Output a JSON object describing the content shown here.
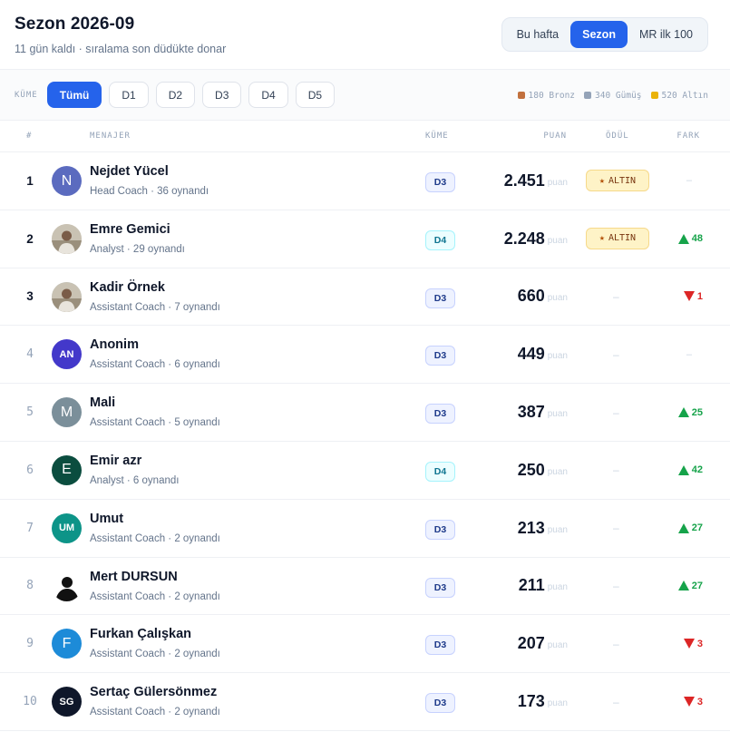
{
  "header": {
    "title": "Sezon 2026-09",
    "subtitle": "11 gün kaldı · sıralama son düdükte donar",
    "tabs": [
      {
        "label": "Bu hafta",
        "active": false
      },
      {
        "label": "Sezon",
        "active": true
      },
      {
        "label": "MR ilk 100",
        "active": false
      }
    ]
  },
  "filters": {
    "label": "KÜME",
    "chips": [
      {
        "label": "Tümü",
        "active": true
      },
      {
        "label": "D1",
        "active": false
      },
      {
        "label": "D2",
        "active": false
      },
      {
        "label": "D3",
        "active": false
      },
      {
        "label": "D4",
        "active": false
      },
      {
        "label": "D5",
        "active": false
      }
    ],
    "legend": [
      {
        "label": "180 Bronz",
        "color": "#c2713e"
      },
      {
        "label": "340 Gümüş",
        "color": "#94a3b8"
      },
      {
        "label": "520 Altın",
        "color": "#eab308"
      }
    ]
  },
  "table": {
    "columns": {
      "rank": "#",
      "manager": "MENAJER",
      "league": "KÜME",
      "points": "PUAN",
      "award": "ÖDÜL",
      "diff": "FARK"
    },
    "points_unit": "puan",
    "rows": [
      {
        "rank": "1",
        "name": "Nejdet Yücel",
        "meta": "Head Coach · 36 oynandı",
        "league": "D3",
        "points": "2.451",
        "award": "ALTIN",
        "diff": "",
        "diff_dir": "none",
        "avatar": {
          "type": "letter",
          "text": "N",
          "color": "#5b6bbf"
        }
      },
      {
        "rank": "2",
        "name": "Emre Gemici",
        "meta": "Analyst · 29 oynandı",
        "league": "D4",
        "points": "2.248",
        "award": "ALTIN",
        "diff": "48",
        "diff_dir": "up",
        "avatar": {
          "type": "photo",
          "color": "#d6cfc2"
        }
      },
      {
        "rank": "3",
        "name": "Kadir Örnek",
        "meta": "Assistant Coach · 7 oynandı",
        "league": "D3",
        "points": "660",
        "award": "",
        "diff": "1",
        "diff_dir": "down",
        "avatar": {
          "type": "photo",
          "color": "#bcd3de"
        }
      },
      {
        "rank": "4",
        "name": "Anonim",
        "meta": "Assistant Coach · 6 oynandı",
        "league": "D3",
        "points": "449",
        "award": "",
        "diff": "",
        "diff_dir": "none",
        "avatar": {
          "type": "initials",
          "text": "AN",
          "color": "#4338ca"
        }
      },
      {
        "rank": "5",
        "name": "Mali",
        "meta": "Assistant Coach · 5 oynandı",
        "league": "D3",
        "points": "387",
        "award": "",
        "diff": "25",
        "diff_dir": "up",
        "avatar": {
          "type": "letter",
          "text": "M",
          "color": "#7b8f9a"
        }
      },
      {
        "rank": "6",
        "name": "Emir azr",
        "meta": "Analyst · 6 oynandı",
        "league": "D4",
        "points": "250",
        "award": "",
        "diff": "42",
        "diff_dir": "up",
        "avatar": {
          "type": "letter",
          "text": "E",
          "color": "#0b4d3f"
        }
      },
      {
        "rank": "7",
        "name": "Umut",
        "meta": "Assistant Coach · 2 oynandı",
        "league": "D3",
        "points": "213",
        "award": "",
        "diff": "27",
        "diff_dir": "up",
        "avatar": {
          "type": "initials",
          "text": "UM",
          "color": "#0d9488"
        }
      },
      {
        "rank": "8",
        "name": "Mert DURSUN",
        "meta": "Assistant Coach · 2 oynandı",
        "league": "D3",
        "points": "211",
        "award": "",
        "diff": "27",
        "diff_dir": "up",
        "avatar": {
          "type": "silhouette",
          "color": "#ffffff"
        }
      },
      {
        "rank": "9",
        "name": "Furkan Çalışkan",
        "meta": "Assistant Coach · 2 oynandı",
        "league": "D3",
        "points": "207",
        "award": "",
        "diff": "3",
        "diff_dir": "down",
        "avatar": {
          "type": "letter",
          "text": "F",
          "color": "#1d8bd8"
        }
      },
      {
        "rank": "10",
        "name": "Sertaç Gülersönmez",
        "meta": "Assistant Coach · 2 oynandı",
        "league": "D3",
        "points": "173",
        "award": "",
        "diff": "3",
        "diff_dir": "down",
        "avatar": {
          "type": "initials",
          "text": "SG",
          "color": "#0f172a"
        }
      }
    ]
  }
}
